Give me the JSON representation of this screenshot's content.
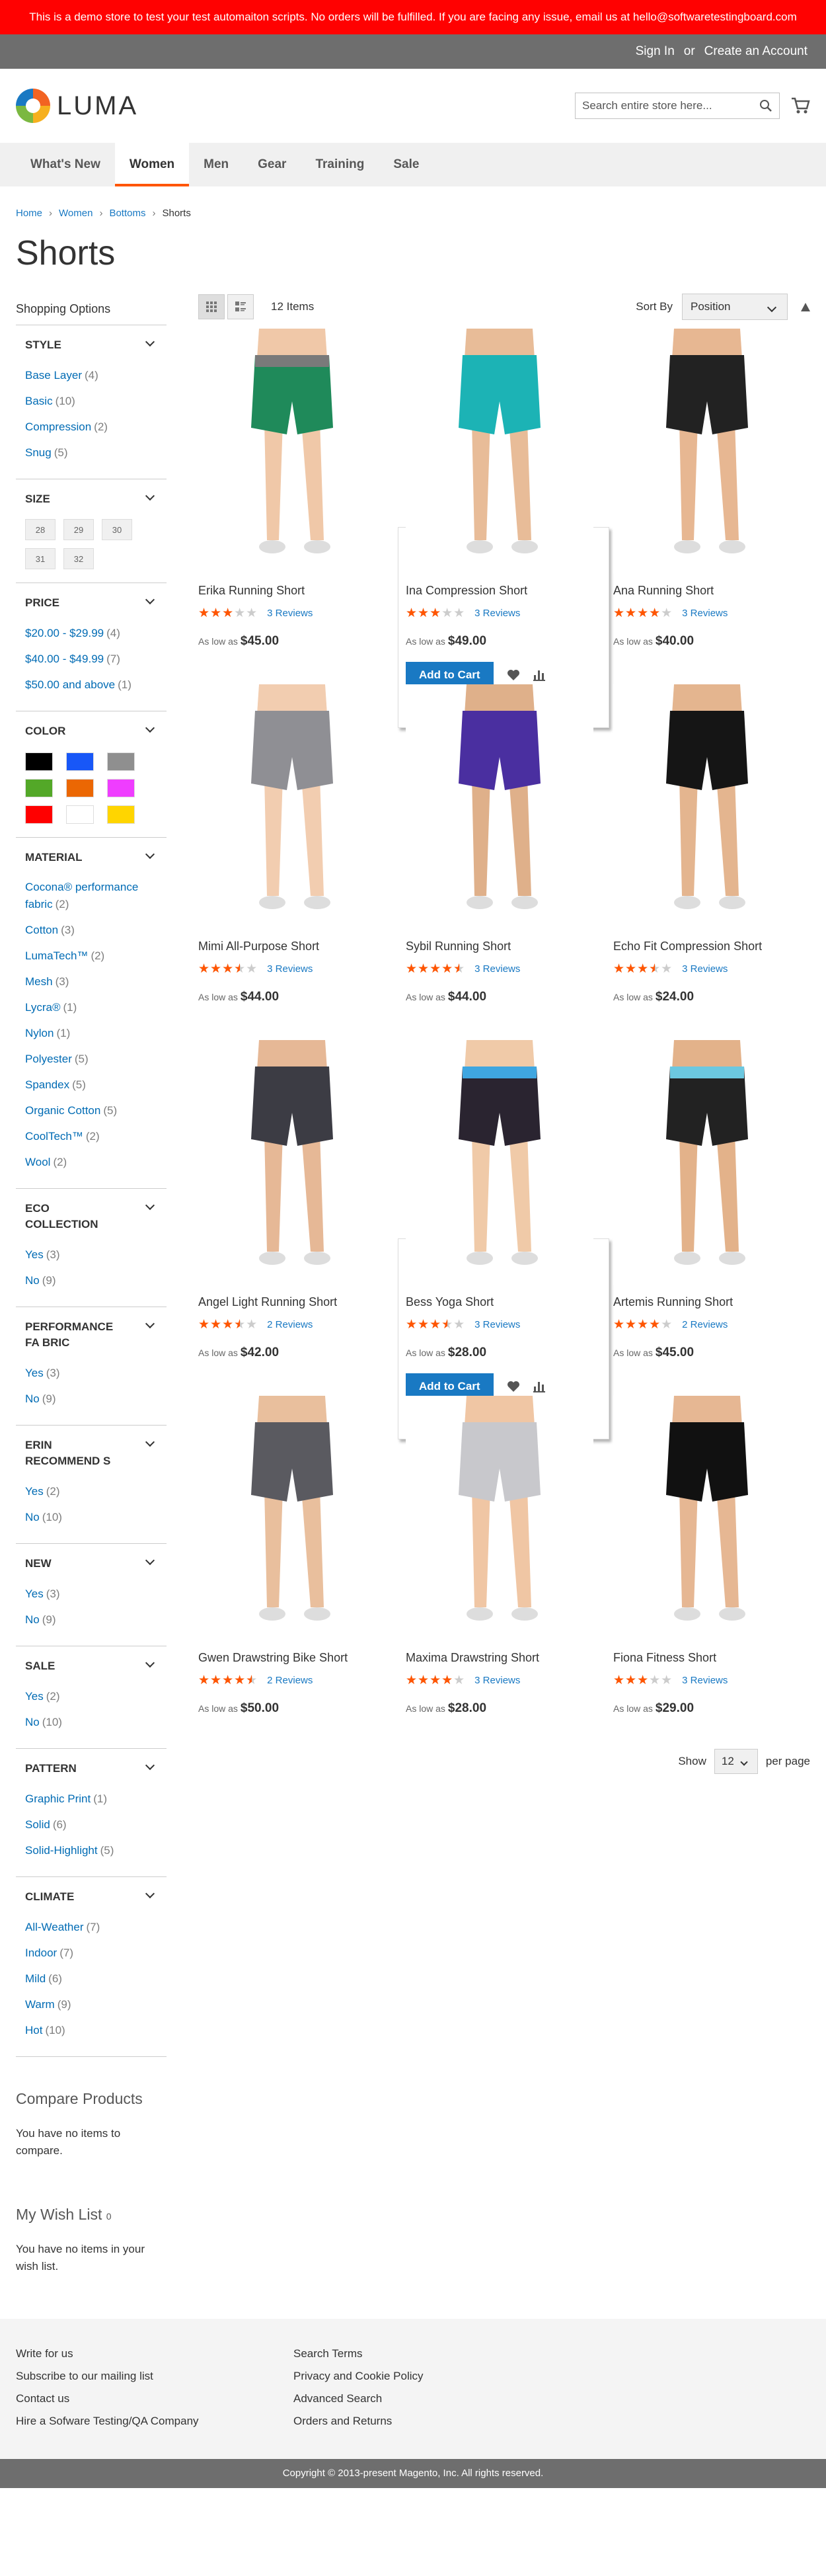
{
  "demo_notice": "This is a demo store to test your test automaiton scripts. No orders will be fulfilled. If you are facing any issue, email us at hello@softwaretestingboard.com",
  "header_links": {
    "sign_in": "Sign In",
    "or": "or",
    "create": "Create an Account"
  },
  "logo_text": "LUMA",
  "search_placeholder": "Search entire store here...",
  "nav": [
    "What's New",
    "Women",
    "Men",
    "Gear",
    "Training",
    "Sale"
  ],
  "breadcrumb": [
    "Home",
    "Women",
    "Bottoms",
    "Shorts"
  ],
  "page_title": "Shorts",
  "shopping_options": "Shopping Options",
  "filters": {
    "style": {
      "title": "Style",
      "items": [
        {
          "label": "Base Layer",
          "count": "(4)"
        },
        {
          "label": "Basic",
          "count": "(10)"
        },
        {
          "label": "Compression",
          "count": "(2)"
        },
        {
          "label": "Snug",
          "count": "(5)"
        }
      ]
    },
    "size": {
      "title": "Size",
      "items": [
        "28",
        "29",
        "30",
        "31",
        "32"
      ]
    },
    "price": {
      "title": "Price",
      "items": [
        {
          "label": "$20.00 - $29.99",
          "count": "(4)"
        },
        {
          "label": "$40.00 - $49.99",
          "count": "(7)"
        },
        {
          "label": "$50.00 and above",
          "count": "(1)"
        }
      ]
    },
    "color": {
      "title": "Color",
      "swatches": [
        "#000000",
        "#1857f7",
        "#8f8f8f",
        "#53a828",
        "#eb6703",
        "#ef3dff",
        "#ff0000",
        "#ffffff",
        "#ffd500"
      ]
    },
    "material": {
      "title": "Material",
      "items": [
        {
          "label": "Cocona® performance fabric",
          "count": "(2)"
        },
        {
          "label": "Cotton",
          "count": "(3)"
        },
        {
          "label": "LumaTech™",
          "count": "(2)"
        },
        {
          "label": "Mesh",
          "count": "(3)"
        },
        {
          "label": "Lycra®",
          "count": "(1)"
        },
        {
          "label": "Nylon",
          "count": "(1)"
        },
        {
          "label": "Polyester",
          "count": "(5)"
        },
        {
          "label": "Spandex",
          "count": "(5)"
        },
        {
          "label": "Organic Cotton",
          "count": "(5)"
        },
        {
          "label": "CoolTech™",
          "count": "(2)"
        },
        {
          "label": "Wool",
          "count": "(2)"
        }
      ]
    },
    "eco": {
      "title": "Eco Collection",
      "items": [
        {
          "label": "Yes",
          "count": "(3)"
        },
        {
          "label": "No",
          "count": "(9)"
        }
      ]
    },
    "perf": {
      "title": "Performance Fa bric",
      "items": [
        {
          "label": "Yes",
          "count": "(3)"
        },
        {
          "label": "No",
          "count": "(9)"
        }
      ]
    },
    "erin": {
      "title": "Erin Recommend s",
      "items": [
        {
          "label": "Yes",
          "count": "(2)"
        },
        {
          "label": "No",
          "count": "(10)"
        }
      ]
    },
    "new": {
      "title": "New",
      "items": [
        {
          "label": "Yes",
          "count": "(3)"
        },
        {
          "label": "No",
          "count": "(9)"
        }
      ]
    },
    "sale": {
      "title": "Sale",
      "items": [
        {
          "label": "Yes",
          "count": "(2)"
        },
        {
          "label": "No",
          "count": "(10)"
        }
      ]
    },
    "pattern": {
      "title": "Pattern",
      "items": [
        {
          "label": "Graphic Print",
          "count": "(1)"
        },
        {
          "label": "Solid",
          "count": "(6)"
        },
        {
          "label": "Solid-Highlight",
          "count": "(5)"
        }
      ]
    },
    "climate": {
      "title": "Climate",
      "items": [
        {
          "label": "All-Weather",
          "count": "(7)"
        },
        {
          "label": "Indoor",
          "count": "(7)"
        },
        {
          "label": "Mild",
          "count": "(6)"
        },
        {
          "label": "Warm",
          "count": "(9)"
        },
        {
          "label": "Hot",
          "count": "(10)"
        }
      ]
    }
  },
  "compare": {
    "title": "Compare Products",
    "text": "You have no items to compare."
  },
  "wishlist": {
    "title": "My Wish List",
    "count": "0",
    "text": "You have no items in your wish list."
  },
  "toolbar": {
    "items": "12 Items",
    "sort_by": "Sort By",
    "sort_value": "Position"
  },
  "products": [
    {
      "name": "Erika Running Short",
      "rating": 0.6,
      "reviews": "3 Reviews",
      "prefix": "As low as",
      "price": "$45.00",
      "shorts": "#1f8a5a",
      "waist": "#7a7a7a",
      "legs": "#f0c8a8"
    },
    {
      "name": "Ina Compression Short",
      "rating": 0.6,
      "reviews": "3 Reviews",
      "prefix": "As low as",
      "price": "$49.00",
      "shorts": "#1cb3b5",
      "waist": "#1cb3b5",
      "legs": "#e8bc98",
      "hover": true,
      "add_to_cart": "Add to Cart"
    },
    {
      "name": "Ana Running Short",
      "rating": 0.8,
      "reviews": "3 Reviews",
      "prefix": "As low as",
      "price": "$40.00",
      "shorts": "#222222",
      "waist": "#222222",
      "legs": "#e7b792"
    },
    {
      "name": "Mimi All-Purpose Short",
      "rating": 0.7,
      "reviews": "3 Reviews",
      "prefix": "As low as",
      "price": "$44.00",
      "shorts": "#8f8f94",
      "waist": "#8f8f94",
      "legs": "#f2cdb0"
    },
    {
      "name": "Sybil Running Short",
      "rating": 0.9,
      "reviews": "3 Reviews",
      "prefix": "As low as",
      "price": "$44.00",
      "shorts": "#4a2fa0",
      "waist": "#4a2fa0",
      "legs": "#dfb08a"
    },
    {
      "name": "Echo Fit Compression Short",
      "rating": 0.7,
      "reviews": "3 Reviews",
      "prefix": "As low as",
      "price": "$24.00",
      "shorts": "#151515",
      "waist": "#151515",
      "legs": "#e4b58f"
    },
    {
      "name": "Angel Light Running Short",
      "rating": 0.7,
      "reviews": "2 Reviews",
      "prefix": "As low as",
      "price": "$42.00",
      "shorts": "#3c3c44",
      "waist": "#3c3c44",
      "legs": "#e6b896"
    },
    {
      "name": "Bess Yoga Short",
      "rating": 0.7,
      "reviews": "3 Reviews",
      "prefix": "As low as",
      "price": "$28.00",
      "shorts": "#2a2430",
      "waist": "#3fa6e0",
      "legs": "#f0caa8",
      "hover": true,
      "add_to_cart": "Add to Cart"
    },
    {
      "name": "Artemis Running Short",
      "rating": 0.8,
      "reviews": "2 Reviews",
      "prefix": "As low as",
      "price": "$45.00",
      "shorts": "#222222",
      "waist": "#6cc8e0",
      "legs": "#e3b28a"
    },
    {
      "name": "Gwen Drawstring Bike Short",
      "rating": 0.9,
      "reviews": "2 Reviews",
      "prefix": "As low as",
      "price": "$50.00",
      "shorts": "#5a5a60",
      "waist": "#5a5a60",
      "legs": "#e9bf9d"
    },
    {
      "name": "Maxima Drawstring Short",
      "rating": 0.8,
      "reviews": "3 Reviews",
      "prefix": "As low as",
      "price": "$28.00",
      "shorts": "#c8c8cc",
      "waist": "#c8c8cc",
      "legs": "#f0c6a4"
    },
    {
      "name": "Fiona Fitness Short",
      "rating": 0.6,
      "reviews": "3 Reviews",
      "prefix": "As low as",
      "price": "$29.00",
      "shorts": "#111111",
      "waist": "#111111",
      "legs": "#e6b793"
    }
  ],
  "pager": {
    "show": "Show",
    "limit": "12",
    "per_page": "per page"
  },
  "footer": {
    "col1": [
      "Write for us",
      "Subscribe to our mailing list",
      "Contact us",
      "Hire a Sofware Testing/QA Company"
    ],
    "col2": [
      "Search Terms",
      "Privacy and Cookie Policy",
      "Advanced Search",
      "Orders and Returns"
    ]
  },
  "copyright": "Copyright © 2013-present Magento, Inc. All rights reserved."
}
